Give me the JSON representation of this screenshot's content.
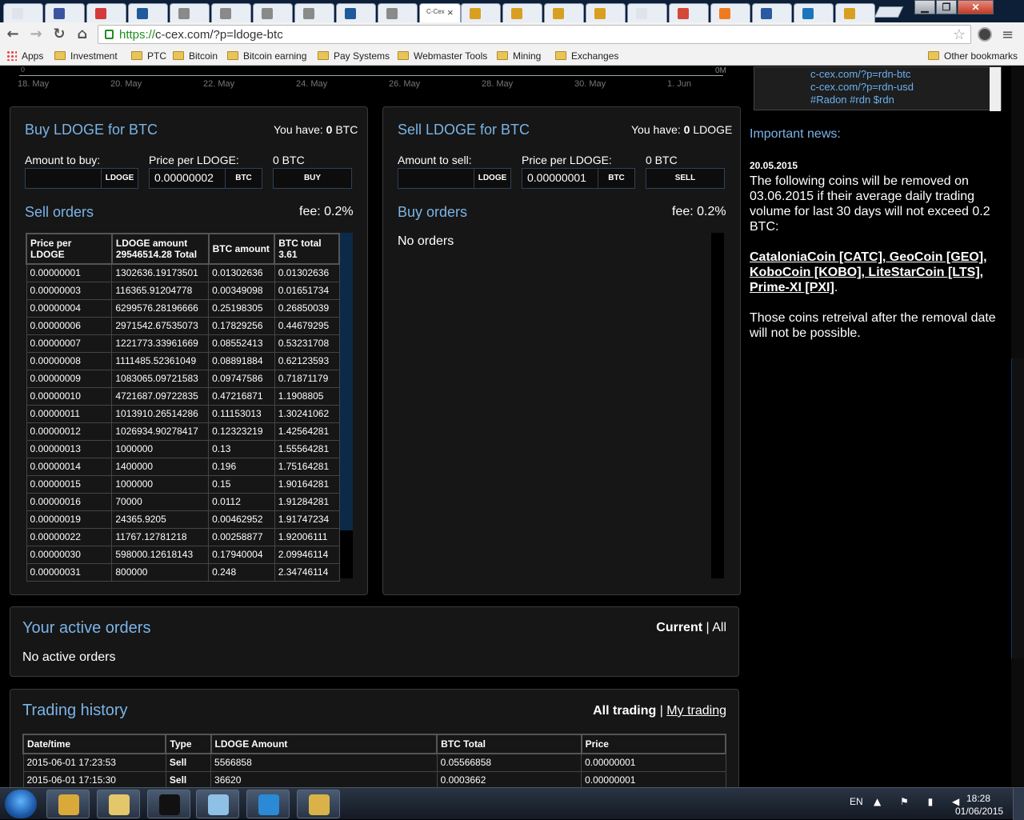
{
  "browser": {
    "tabs": [
      {
        "icon": "blank-page-icon",
        "color": "#dfe4ea"
      },
      {
        "icon": "n-app-icon",
        "color": "#3a55a0"
      },
      {
        "icon": "red-app-icon",
        "color": "#d33a3a"
      },
      {
        "icon": "b-app-icon",
        "color": "#1f5a9a"
      },
      {
        "icon": "bird-icon",
        "color": "#8a8a8a"
      },
      {
        "icon": "bird-icon",
        "color": "#8a8a8a"
      },
      {
        "icon": "bird-icon",
        "color": "#8a8a8a"
      },
      {
        "icon": "bird-icon",
        "color": "#8a8a8a"
      },
      {
        "icon": "b-app-icon",
        "color": "#1f5a9a"
      },
      {
        "icon": "bird-icon",
        "color": "#8a8a8a"
      },
      {
        "icon": "ccex-icon",
        "active": true,
        "title": "C-Cex"
      },
      {
        "icon": "bitcoin-icon",
        "color": "#d8a020"
      },
      {
        "icon": "bitcoin-icon",
        "color": "#d8a020"
      },
      {
        "icon": "bitcoin-icon",
        "color": "#d8a020"
      },
      {
        "icon": "bitcoin-icon",
        "color": "#d8a020"
      },
      {
        "icon": "blank-page-icon",
        "color": "#dfe4ea"
      },
      {
        "icon": "gmail-icon",
        "color": "#d34836"
      },
      {
        "icon": "avast-icon",
        "color": "#f07a20"
      },
      {
        "icon": "x-tools-icon",
        "color": "#2a5aa0"
      },
      {
        "icon": "dash-icon",
        "color": "#1c75bc"
      },
      {
        "icon": "bitcoin-icon",
        "color": "#d8a020"
      }
    ],
    "url_scheme": "https://",
    "url_rest": "c-cex.com/?p=ldoge-btc",
    "bookmarks": [
      {
        "label": "Apps",
        "icon": "apps-icon"
      },
      {
        "label": "Investment",
        "icon": "folder-icon"
      },
      {
        "label": "PTC",
        "icon": "folder-icon"
      },
      {
        "label": "Bitcoin",
        "icon": "folder-icon"
      },
      {
        "label": "Bitcoin earning",
        "icon": "folder-icon"
      },
      {
        "label": "Pay Systems",
        "icon": "folder-icon"
      },
      {
        "label": "Webmaster Tools",
        "icon": "folder-icon"
      },
      {
        "label": "Mining",
        "icon": "folder-icon"
      },
      {
        "label": "Exchanges",
        "icon": "folder-icon"
      }
    ],
    "other_bookmarks": "Other bookmarks",
    "minimize": "▁",
    "restore": "❐",
    "close": "✕"
  },
  "chart": {
    "ticks": [
      "18. May",
      "20. May",
      "22. May",
      "24. May",
      "26. May",
      "28. May",
      "30. May",
      "1. Jun"
    ],
    "zero_label": "0",
    "volume_label": "0M"
  },
  "buy_panel": {
    "title": "Buy LDOGE for BTC",
    "you_have_label": "You have:",
    "you_have_value": "0",
    "you_have_unit": "BTC",
    "amount_label": "Amount to buy:",
    "amount_value": "",
    "amount_unit": "LDOGE",
    "price_label": "Price per LDOGE:",
    "price_value": "0.00000002",
    "price_unit": "BTC",
    "total": "0 BTC",
    "button": "BUY",
    "orders_title": "Sell orders",
    "fee": "fee: 0.2%",
    "columns": [
      {
        "main": "Price per LDOGE",
        "sub": ""
      },
      {
        "main": "LDOGE amount",
        "sub": "29546514.28 Total"
      },
      {
        "main": "BTC amount",
        "sub": ""
      },
      {
        "main": "BTC total",
        "sub": "3.61"
      }
    ],
    "rows": [
      [
        "0.00000001",
        "1302636.19173501",
        "0.01302636",
        "0.01302636"
      ],
      [
        "0.00000003",
        "116365.91204778",
        "0.00349098",
        "0.01651734"
      ],
      [
        "0.00000004",
        "6299576.28196666",
        "0.25198305",
        "0.26850039"
      ],
      [
        "0.00000006",
        "2971542.67535073",
        "0.17829256",
        "0.44679295"
      ],
      [
        "0.00000007",
        "1221773.33961669",
        "0.08552413",
        "0.53231708"
      ],
      [
        "0.00000008",
        "1111485.52361049",
        "0.08891884",
        "0.62123593"
      ],
      [
        "0.00000009",
        "1083065.09721583",
        "0.09747586",
        "0.71871179"
      ],
      [
        "0.00000010",
        "4721687.09722835",
        "0.47216871",
        "1.1908805"
      ],
      [
        "0.00000011",
        "1013910.26514286",
        "0.11153013",
        "1.30241062"
      ],
      [
        "0.00000012",
        "1026934.90278417",
        "0.12323219",
        "1.42564281"
      ],
      [
        "0.00000013",
        "1000000",
        "0.13",
        "1.55564281"
      ],
      [
        "0.00000014",
        "1400000",
        "0.196",
        "1.75164281"
      ],
      [
        "0.00000015",
        "1000000",
        "0.15",
        "1.90164281"
      ],
      [
        "0.00000016",
        "70000",
        "0.0112",
        "1.91284281"
      ],
      [
        "0.00000019",
        "24365.9205",
        "0.00462952",
        "1.91747234"
      ],
      [
        "0.00000022",
        "11767.12781218",
        "0.00258877",
        "1.92006111"
      ],
      [
        "0.00000030",
        "598000.12618143",
        "0.17940004",
        "2.09946114"
      ],
      [
        "0.00000031",
        "800000",
        "0.248",
        "2.34746114"
      ]
    ]
  },
  "sell_panel": {
    "title": "Sell LDOGE for BTC",
    "you_have_label": "You have:",
    "you_have_value": "0",
    "you_have_unit": "LDOGE",
    "amount_label": "Amount to sell:",
    "amount_value": "",
    "amount_unit": "LDOGE",
    "price_label": "Price per LDOGE:",
    "price_value": "0.00000001",
    "price_unit": "BTC",
    "total": "0 BTC",
    "button": "SELL",
    "orders_title": "Buy orders",
    "fee": "fee: 0.2%",
    "empty": "No orders"
  },
  "active_orders": {
    "title": "Your active orders",
    "filter_current": "Current",
    "filter_sep": "|",
    "filter_all": "All",
    "empty": "No active orders"
  },
  "history": {
    "title": "Trading history",
    "filter_all": "All trading",
    "filter_sep": "|",
    "filter_mine": "My trading",
    "columns": [
      "Date/time",
      "Type",
      "LDOGE Amount",
      "BTC Total",
      "Price"
    ],
    "rows": [
      [
        "2015-06-01 17:23:53",
        "Sell",
        "5566858",
        "0.05566858",
        "0.00000001"
      ],
      [
        "2015-06-01 17:15:30",
        "Sell",
        "36620",
        "0.0003662",
        "0.00000001"
      ]
    ]
  },
  "sidebar": {
    "links": [
      "c-cex.com/?p=rdn-btc",
      "c-cex.com/?p=rdn-usd",
      "#Radon #rdn $rdn"
    ],
    "news_heading": "Important news:",
    "news_date": "20.05.2015",
    "news_p1": "The following coins will be removed on 03.06.2015 if their average daily trading volume for last 30 days will not exceed 0.2 BTC:",
    "news_coins": "CataloniaCoin [CATC], GeoCoin [GEO], KoboCoin [KOBO], LiteStarCoin [LTS], Prime-XI [PXI]",
    "news_coins_end": ".",
    "news_p2": "Those coins retreival after the removal date will not be possible."
  },
  "taskbar": {
    "apps": [
      {
        "name": "chrome-icon",
        "color": "#d9a93a"
      },
      {
        "name": "explorer-icon",
        "color": "#e3c76a"
      },
      {
        "name": "cmd-icon",
        "color": "#111111"
      },
      {
        "name": "notepad-icon",
        "color": "#8fc0e6"
      },
      {
        "name": "teamviewer-icon",
        "color": "#2a8ad6"
      },
      {
        "name": "app-globe-icon",
        "color": "#d9b34a"
      }
    ],
    "lang": "EN",
    "tray": "▲ ⚑ ▮ ◀",
    "time": "18:28",
    "date": "01/06/2015"
  }
}
